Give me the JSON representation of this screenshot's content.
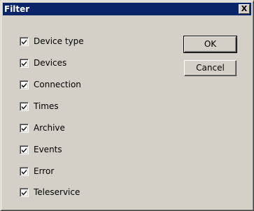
{
  "window": {
    "title": "Filter",
    "close_label": "X"
  },
  "checkboxes": [
    {
      "label": "Device type",
      "checked": true
    },
    {
      "label": "Devices",
      "checked": true
    },
    {
      "label": "Connection",
      "checked": true
    },
    {
      "label": "Times",
      "checked": true
    },
    {
      "label": "Archive",
      "checked": true
    },
    {
      "label": "Events",
      "checked": true
    },
    {
      "label": "Error",
      "checked": true
    },
    {
      "label": "Teleservice",
      "checked": true
    }
  ],
  "buttons": {
    "ok_label": "OK",
    "cancel_label": "Cancel"
  },
  "colors": {
    "titlebar": "#0a246a",
    "face": "#d4d0c8"
  }
}
